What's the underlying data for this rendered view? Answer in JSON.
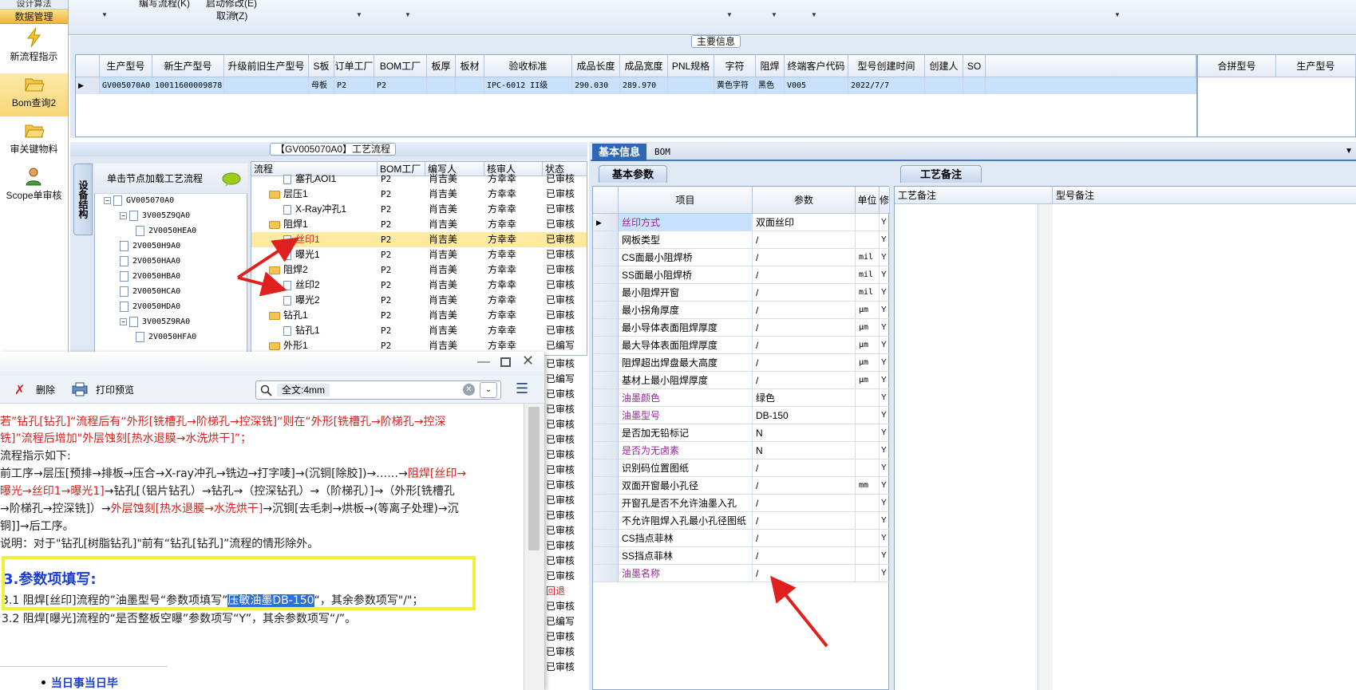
{
  "left_nav": {
    "header_top": "设计算法",
    "header_active": "数据管理",
    "items": [
      {
        "label": "新流程指示"
      },
      {
        "label": "Bom查询2"
      },
      {
        "label": "审关键物料"
      },
      {
        "label": "Scope单审核"
      }
    ]
  },
  "toolbar": {
    "btn_edit_flow": "编写流程(K)",
    "btn_start_change": "启动修改(E)",
    "btn_cancel": "取消(Z)"
  },
  "main_info": {
    "caption": "主要信息",
    "columns": [
      "生产型号",
      "新生产型号",
      "升级前旧生产型号",
      "S板",
      "订单工厂",
      "BOM工厂",
      "板厚",
      "板材",
      "验收标准",
      "成品长度",
      "成品宽度",
      "PNL规格",
      "字符",
      "阻焊",
      "终端客户代码",
      "型号创建时间",
      "创建人",
      "SO"
    ],
    "row": [
      "GV005070A0",
      "10011600009878",
      "",
      "母板",
      "P2",
      "P2",
      "",
      "",
      "IPC-6012 II级",
      "290.030",
      "289.970",
      "",
      "黄色字符",
      "黑色",
      "V005",
      "2022/7/7",
      "",
      ""
    ],
    "right_columns": [
      "合拼型号",
      "生产型号"
    ]
  },
  "process": {
    "caption": "【GV005070A0】工艺流程",
    "vertical_tab": "设备结构",
    "tip": "单击节点加载工艺流程",
    "tree": [
      "GV005070A0",
      "3V005Z9QA0",
      "2V0050HEA0",
      "2V0050H9A0",
      "2V0050HAA0",
      "2V0050HBA0",
      "2V0050HCA0",
      "2V0050HDA0",
      "3V005Z9RA0",
      "2V0050HFA0"
    ],
    "flow_columns": [
      "流程",
      "BOM工厂",
      "编写人",
      "核审人",
      "状态"
    ],
    "flow_rows": [
      {
        "name": "塞孔AOI1",
        "type": "doc",
        "level": 2,
        "factory": "P2",
        "writer": "肖吉美",
        "checker": "方幸幸",
        "status": "已审核"
      },
      {
        "name": "层压1",
        "type": "folder",
        "level": 1,
        "factory": "P2",
        "writer": "肖吉美",
        "checker": "方幸幸",
        "status": "已审核"
      },
      {
        "name": "X-Ray冲孔1",
        "type": "doc",
        "level": 2,
        "factory": "P2",
        "writer": "肖吉美",
        "checker": "方幸幸",
        "status": "已审核"
      },
      {
        "name": "阻焊1",
        "type": "folder",
        "level": 1,
        "factory": "P2",
        "writer": "肖吉美",
        "checker": "方幸幸",
        "status": "已审核"
      },
      {
        "name": "丝印1",
        "type": "doc",
        "level": 2,
        "factory": "P2",
        "writer": "肖吉美",
        "checker": "方幸幸",
        "status": "已审核",
        "selected": true
      },
      {
        "name": "曝光1",
        "type": "doc",
        "level": 2,
        "factory": "P2",
        "writer": "肖吉美",
        "checker": "方幸幸",
        "status": "已审核"
      },
      {
        "name": "阻焊2",
        "type": "folder",
        "level": 1,
        "factory": "P2",
        "writer": "肖吉美",
        "checker": "方幸幸",
        "status": "已审核"
      },
      {
        "name": "丝印2",
        "type": "doc",
        "level": 2,
        "factory": "P2",
        "writer": "肖吉美",
        "checker": "方幸幸",
        "status": "已审核"
      },
      {
        "name": "曝光2",
        "type": "doc",
        "level": 2,
        "factory": "P2",
        "writer": "肖吉美",
        "checker": "方幸幸",
        "status": "已审核"
      },
      {
        "name": "钻孔1",
        "type": "folder",
        "level": 1,
        "factory": "P2",
        "writer": "肖吉美",
        "checker": "方幸幸",
        "status": "已审核"
      },
      {
        "name": "钻孔1",
        "type": "doc",
        "level": 2,
        "factory": "P2",
        "writer": "肖吉美",
        "checker": "方幸幸",
        "status": "已审核"
      },
      {
        "name": "外形1",
        "type": "folder",
        "level": 1,
        "factory": "P2",
        "writer": "肖吉美",
        "checker": "方幸幸",
        "status": "已编写"
      }
    ],
    "status_overflow": [
      "已审核",
      "已编写",
      "已审核",
      "已审核",
      "已审核",
      "已审核",
      "已审核",
      "已审核",
      "已审核",
      "已审核",
      "已审核",
      "已审核",
      "已审核",
      "已审核",
      "已审核",
      "回退",
      "已审核",
      "已编写",
      "已审核",
      "已审核",
      "已审核"
    ]
  },
  "right_panel": {
    "tabs": [
      "基本信息",
      "BOM"
    ],
    "subtab": "基本参数",
    "param_columns": [
      "项目",
      "参数",
      "单位",
      "修"
    ],
    "params": [
      {
        "item": "丝印方式",
        "value": "双面丝印",
        "unit": "",
        "flag": "Y",
        "purple": true,
        "current": true
      },
      {
        "item": "网板类型",
        "value": "/",
        "unit": "",
        "flag": "Y"
      },
      {
        "item": "CS面最小阻焊桥",
        "value": "/",
        "unit": "mil",
        "flag": "Y"
      },
      {
        "item": "SS面最小阻焊桥",
        "value": "/",
        "unit": "mil",
        "flag": "Y"
      },
      {
        "item": "最小阻焊开窗",
        "value": "/",
        "unit": "mil",
        "flag": "Y"
      },
      {
        "item": "最小拐角厚度",
        "value": "/",
        "unit": "μm",
        "flag": "Y"
      },
      {
        "item": "最小导体表面阻焊厚度",
        "value": "/",
        "unit": "μm",
        "flag": "Y"
      },
      {
        "item": "最大导体表面阻焊厚度",
        "value": "/",
        "unit": "μm",
        "flag": "Y"
      },
      {
        "item": "阻焊超出焊盘最大高度",
        "value": "/",
        "unit": "μm",
        "flag": "Y"
      },
      {
        "item": "基材上最小阻焊厚度",
        "value": "/",
        "unit": "μm",
        "flag": "Y"
      },
      {
        "item": "油墨颜色",
        "value": "绿色",
        "unit": "",
        "flag": "Y",
        "purple": true
      },
      {
        "item": "油墨型号",
        "value": "DB-150",
        "unit": "",
        "flag": "Y",
        "purple": true
      },
      {
        "item": "是否加无铅标记",
        "value": "N",
        "unit": "",
        "flag": "Y"
      },
      {
        "item": "是否为无卤素",
        "value": "N",
        "unit": "",
        "flag": "Y",
        "purple": true
      },
      {
        "item": "识别码位置图纸",
        "value": "/",
        "unit": "",
        "flag": "Y"
      },
      {
        "item": "双面开窗最小孔径",
        "value": "/",
        "unit": "mm",
        "flag": "Y"
      },
      {
        "item": "开窗孔是否不允许油墨入孔",
        "value": "/",
        "unit": "",
        "flag": "Y"
      },
      {
        "item": "不允许阻焊入孔最小孔径图纸",
        "value": "/",
        "unit": "",
        "flag": "Y"
      },
      {
        "item": "CS挡点菲林",
        "value": "/",
        "unit": "",
        "flag": "Y"
      },
      {
        "item": "SS挡点菲林",
        "value": "/",
        "unit": "",
        "flag": "Y"
      },
      {
        "item": "油墨名称",
        "value": "/",
        "unit": "",
        "flag": "Y",
        "purple": true
      }
    ],
    "notes_tab": "工艺备注",
    "notes_columns": [
      "工艺备注",
      "型号备注"
    ]
  },
  "doc_window": {
    "btn_delete": "删除",
    "btn_print_preview": "打印预览",
    "search_value": "全文:4mm",
    "lines": [
      {
        "parts": [
          {
            "t": "若”钻孔[钻孔]“流程后有“外形[铣槽孔→阶梯孔→控深铣]“则在“外形[铣槽孔→阶梯孔→控深",
            "red": true
          }
        ]
      },
      {
        "parts": [
          {
            "t": "铣]”流程后增加\"外层蚀刻[热水退膜→水洗烘干]”；",
            "red": true
          }
        ]
      },
      {
        "parts": [
          {
            "t": "流程指示如下:",
            "red": false
          }
        ]
      },
      {
        "parts": [
          {
            "t": "前工序→层压[预排→排板→压合→X-ray冲孔→铣边→打字唛]→(沉铜[除胶])→……→",
            "red": false
          },
          {
            "t": "阻焊[丝印→",
            "red": true
          }
        ]
      },
      {
        "parts": [
          {
            "t": "曝光→丝印1→曝光1]",
            "red": true
          },
          {
            "t": "→钻孔[（铝片钻孔）→钻孔→（控深钻孔）→（阶梯孔）]→（外形[铣槽孔",
            "red": false
          }
        ]
      },
      {
        "parts": [
          {
            "t": "→阶梯孔→控深铣]）→",
            "red": false
          },
          {
            "t": "外层蚀刻[热水退膜→水洗烘干]",
            "red": true
          },
          {
            "t": "→沉铜[去毛刺→烘板→(等离子处理)→沉",
            "red": false
          }
        ]
      },
      {
        "parts": [
          {
            "t": "铜]]→后工序。",
            "red": false
          }
        ]
      },
      {
        "parts": [
          {
            "t": "说明：对于\"钻孔[树脂钻孔]\"前有“钻孔[钻孔]”流程的情形除外。",
            "red": false
          }
        ]
      }
    ],
    "heading": "3.参数项填写:",
    "line31_a": "3.1 阻焊[丝印]流程的”油墨型号“参数项填写”",
    "line31_sel": "压敏油墨DB-150",
    "line31_b": "“，其余参数项写\"/\"；",
    "line32": "3.2 阻焊[曝光]流程的“是否整板空曝”参数项写“Y”，其余参数项写“/”。",
    "bullet": "当日事当日毕"
  },
  "colors": {
    "accent": "#2e6fd9",
    "highlight_box": "#f0f03a",
    "arrow": "#e0201e",
    "selected_row": "#c9e2fb"
  }
}
